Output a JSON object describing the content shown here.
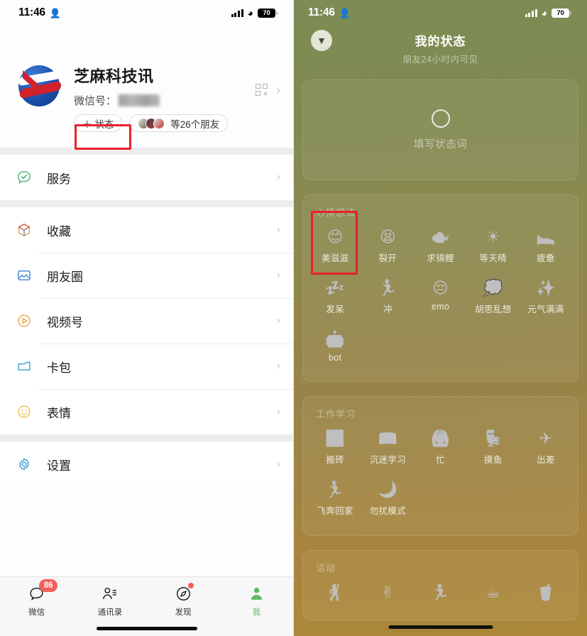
{
  "status_bar": {
    "time": "11:46",
    "person_icon": "person-icon",
    "signal_icon": "cellular-bars-icon",
    "wifi_icon": "wifi-icon",
    "battery_level": "70"
  },
  "left": {
    "profile": {
      "avatar_name": "zhima-logo-avatar",
      "name": "芝麻科技讯",
      "wechat_id_label": "微信号：",
      "wechat_id_value": "p•••••shi",
      "status_chip_label": "＋ 状态",
      "friends_chip_label": "等26个朋友",
      "qr_icon": "qr-code-icon",
      "chevron_icon": "chevron-right-icon"
    },
    "menu_groups": [
      {
        "items": [
          {
            "label": "服务",
            "icon": "services-check-bubble-icon",
            "color": "#4caf6d"
          }
        ]
      },
      {
        "items": [
          {
            "label": "收藏",
            "icon": "favorites-box-icon",
            "color": "#e8a33d"
          },
          {
            "label": "朋友圈",
            "icon": "moments-photo-icon",
            "color": "#3b7fd4"
          },
          {
            "label": "视频号",
            "icon": "channels-play-icon",
            "color": "#e8a33d"
          },
          {
            "label": "卡包",
            "icon": "cards-wallet-icon",
            "color": "#3b9fd4"
          },
          {
            "label": "表情",
            "icon": "stickers-smiley-icon",
            "color": "#e8c23d"
          }
        ]
      },
      {
        "items": [
          {
            "label": "设置",
            "icon": "settings-gear-icon",
            "color": "#3b9fd4"
          }
        ]
      }
    ],
    "tabbar": [
      {
        "label": "微信",
        "icon": "chat-bubble-icon",
        "badge": "86",
        "active": false
      },
      {
        "label": "通讯录",
        "icon": "contacts-icon",
        "badge": "",
        "active": false
      },
      {
        "label": "发现",
        "icon": "discover-compass-icon",
        "badge": "",
        "dot": true,
        "active": false
      },
      {
        "label": "我",
        "icon": "me-person-icon",
        "badge": "",
        "active": true
      }
    ]
  },
  "right": {
    "header": {
      "back_icon": "chevron-down-icon",
      "title": "我的状态",
      "subtitle": "朋友24小时内可见"
    },
    "status_input": {
      "spinner_icon": "loading-circle-icon",
      "placeholder": "填写状态词"
    },
    "sections": [
      {
        "title": "心情想法",
        "items": [
          {
            "label": "美滋滋",
            "icon": "😊",
            "selected": true
          },
          {
            "label": "裂开",
            "icon": "😫"
          },
          {
            "label": "求锦鲤",
            "icon": "🐟"
          },
          {
            "label": "等天晴",
            "icon": "☀"
          },
          {
            "label": "疲惫",
            "icon": "🛌"
          },
          {
            "label": "发呆",
            "icon": "💤"
          },
          {
            "label": "冲",
            "icon": "🏃"
          },
          {
            "label": "emo",
            "icon": "😔"
          },
          {
            "label": "胡思乱想",
            "icon": "💭"
          },
          {
            "label": "元气满满",
            "icon": "✨"
          },
          {
            "label": "bot",
            "icon": "🤖"
          }
        ]
      },
      {
        "title": "工作学习",
        "items": [
          {
            "label": "搬砖",
            "icon": "🧱"
          },
          {
            "label": "沉迷学习",
            "icon": "📖"
          },
          {
            "label": "忙",
            "icon": "🙆"
          },
          {
            "label": "摸鱼",
            "icon": "💺"
          },
          {
            "label": "出差",
            "icon": "✈"
          },
          {
            "label": "飞奔回家",
            "icon": "🏃"
          },
          {
            "label": "勿扰模式",
            "icon": "🌙"
          }
        ]
      },
      {
        "title": "活动",
        "items": [
          {
            "label": "",
            "icon": "🕺"
          },
          {
            "label": "",
            "icon": "✌"
          },
          {
            "label": "",
            "icon": "🏃"
          },
          {
            "label": "",
            "icon": "☕"
          },
          {
            "label": "",
            "icon": "🧋"
          }
        ]
      }
    ]
  },
  "annotations": {
    "highlight_color": "#e8222a",
    "boxes": [
      "status-chip-highlight",
      "mood-meizizi-highlight"
    ]
  }
}
